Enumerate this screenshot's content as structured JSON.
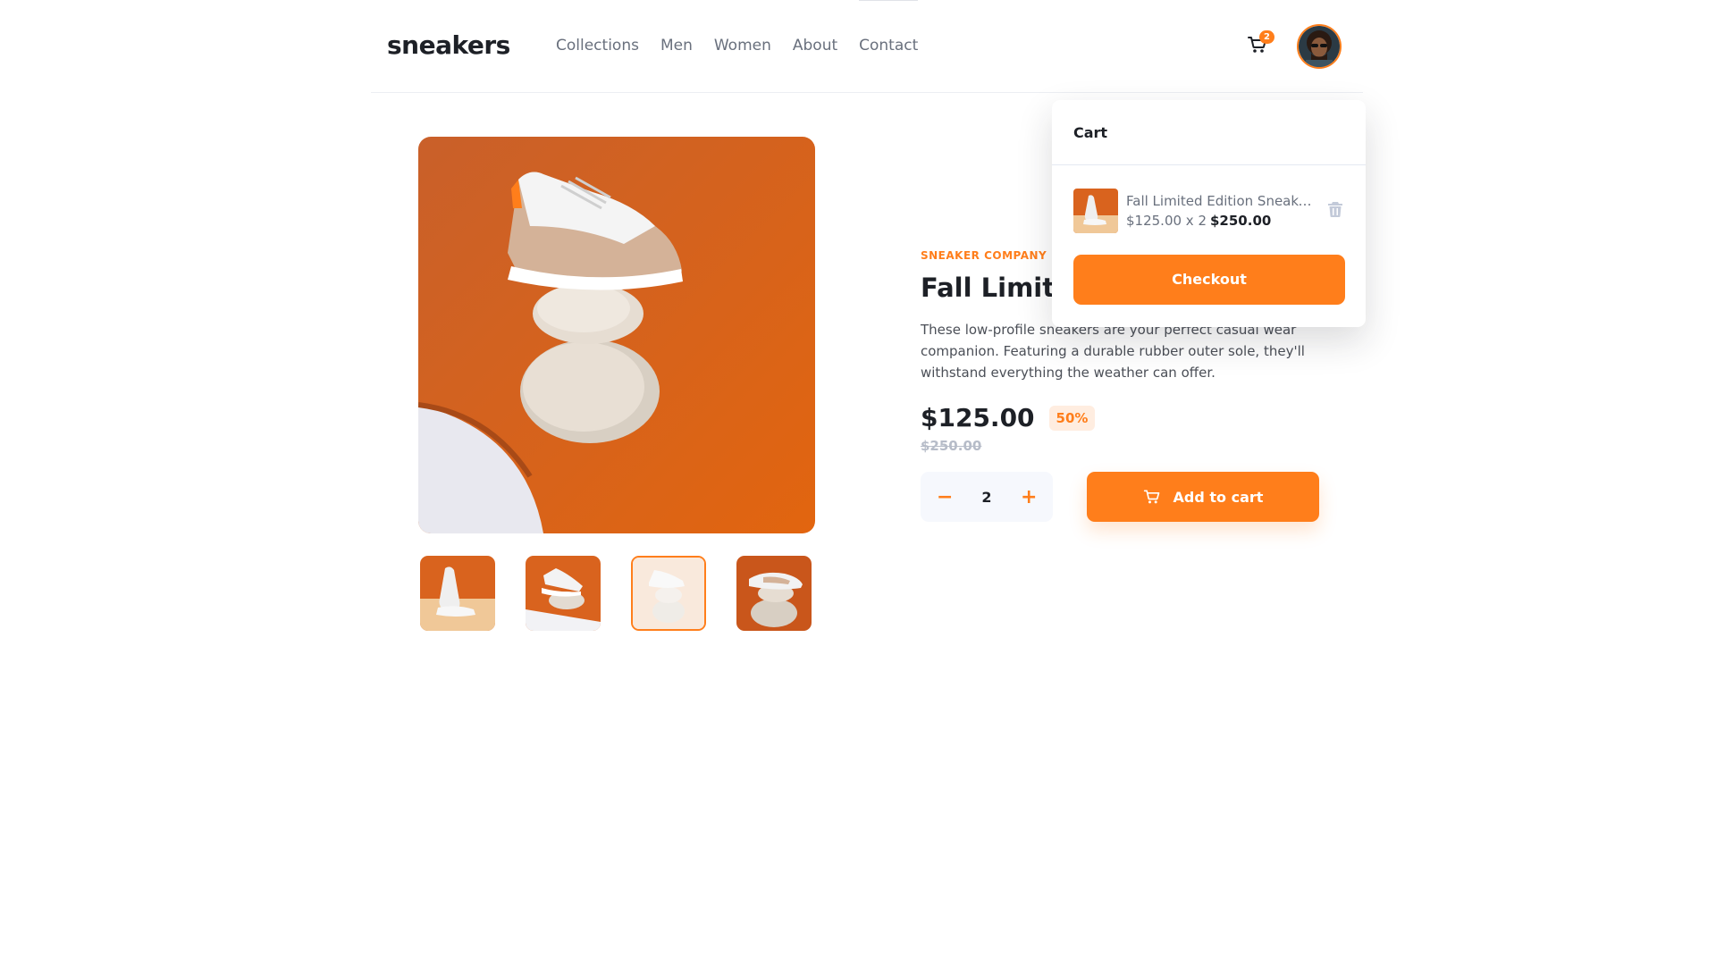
{
  "brand": {
    "logo": "sneakers",
    "accent": "#ff7e1b",
    "pale_accent": "#ffede0"
  },
  "nav": [
    {
      "label": "Collections"
    },
    {
      "label": "Men"
    },
    {
      "label": "Women"
    },
    {
      "label": "About"
    },
    {
      "label": "Contact"
    }
  ],
  "header": {
    "cart_icon": "cart-icon",
    "cart_count": "2",
    "avatar": "user-avatar"
  },
  "product": {
    "company": "SNEAKER COMPANY",
    "title": "Fall Limited",
    "description": "These low-profile sneakers are your perfect casual wear companion. Featuring a durable rubber outer sole, they'll withstand everything the weather can offer.",
    "price": "$125.00",
    "discount": "50%",
    "old_price": "$250.00",
    "selected_thumbnail": 3,
    "thumbnails": [
      "thumbnail-1",
      "thumbnail-2",
      "thumbnail-3",
      "thumbnail-4"
    ]
  },
  "purchase": {
    "minus_label": "−",
    "plus_label": "+",
    "quantity": "2",
    "add_label": "Add to cart"
  },
  "cart": {
    "title": "Cart",
    "item_name": "Fall Limited Edition Sneakers",
    "item_line": "$125.00 x 2",
    "item_total": "$250.00",
    "delete_icon": "trash-icon",
    "checkout_label": "Checkout"
  }
}
